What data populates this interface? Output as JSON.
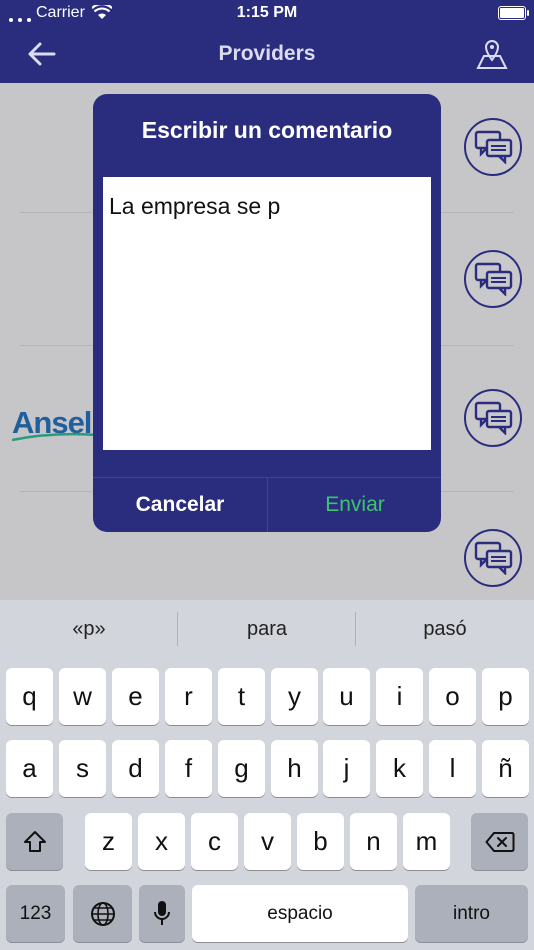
{
  "status": {
    "carrier": "Carrier",
    "time": "1:15 PM"
  },
  "nav": {
    "title": "Providers",
    "back_icon": "arrow-left-icon",
    "map_icon": "map-pin-icon"
  },
  "list": {
    "logo_text": "Ansel"
  },
  "dialog": {
    "title": "Escribir un comentario",
    "text_value": "La empresa se p",
    "cancel_label": "Cancelar",
    "send_label": "Enviar"
  },
  "keyboard": {
    "suggestions": [
      "«p»",
      "para",
      "pasó"
    ],
    "row1": [
      "q",
      "w",
      "e",
      "r",
      "t",
      "y",
      "u",
      "i",
      "o",
      "p"
    ],
    "row2": [
      "a",
      "s",
      "d",
      "f",
      "g",
      "h",
      "j",
      "k",
      "l",
      "ñ"
    ],
    "row3": [
      "z",
      "x",
      "c",
      "v",
      "b",
      "n",
      "m"
    ],
    "numbers_label": "123",
    "space_label": "espacio",
    "return_label": "intro"
  },
  "colors": {
    "brand": "#2a2d7e",
    "send": "#3cc46c"
  }
}
